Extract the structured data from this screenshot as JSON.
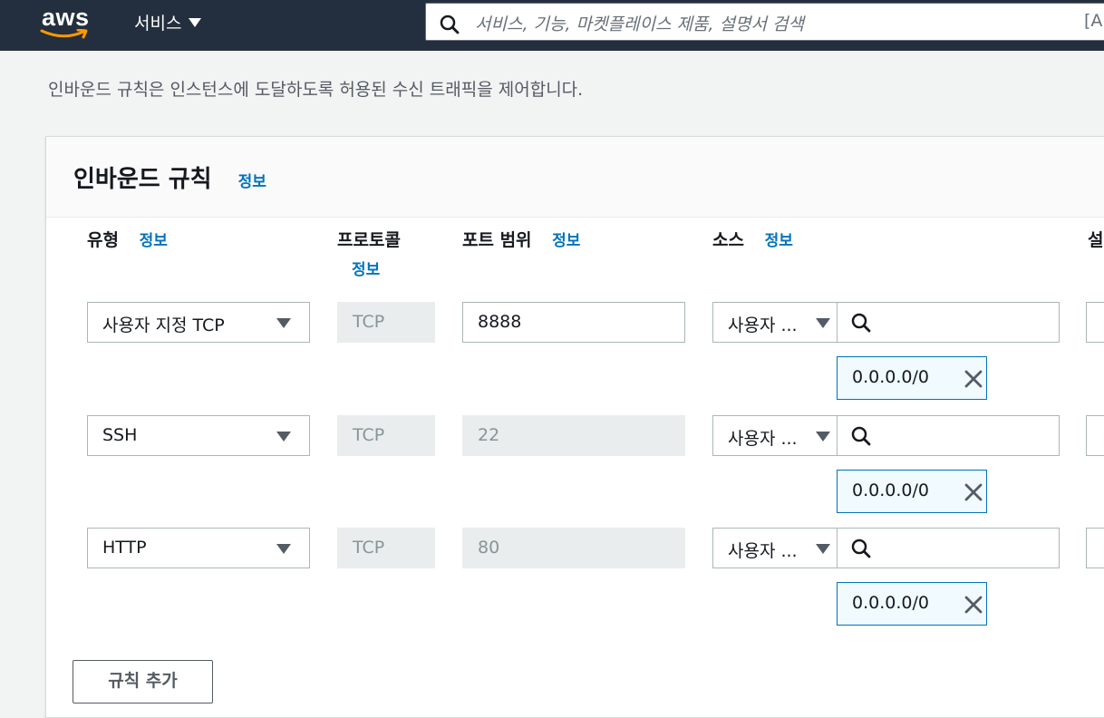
{
  "header": {
    "logo_text": "aws",
    "services_label": "서비스",
    "search_placeholder": "서비스, 기능, 마켓플레이스 제품, 설명서 검색",
    "search_shortcut": "[A"
  },
  "intro": "인바운드 규칙은 인스턴스에 도달하도록 허용된 수신 트래픽을 제어합니다.",
  "panel": {
    "title": "인바운드 규칙",
    "title_info": "정보",
    "columns": {
      "type": "유형",
      "type_info": "정보",
      "protocol": "프로토콜",
      "protocol_info": "정보",
      "port": "포트 범위",
      "port_info": "정보",
      "source": "소스",
      "source_info": "정보",
      "description_partial": "설"
    },
    "rules": [
      {
        "type": "사용자 지정 TCP",
        "protocol": "TCP",
        "port": "8888",
        "port_editable": true,
        "source_type": "사용자 ...",
        "source_token": "0.0.0.0/0"
      },
      {
        "type": "SSH",
        "protocol": "TCP",
        "port": "22",
        "port_editable": false,
        "source_type": "사용자 ...",
        "source_token": "0.0.0.0/0"
      },
      {
        "type": "HTTP",
        "protocol": "TCP",
        "port": "80",
        "port_editable": false,
        "source_type": "사용자 ...",
        "source_token": "0.0.0.0/0"
      }
    ],
    "add_rule_label": "규칙 추가"
  },
  "colors": {
    "topbar": "#232f3e",
    "accent_orange": "#ff9900",
    "link_blue": "#0073bb"
  },
  "icons": [
    "search-icon",
    "caret-down-icon",
    "close-icon"
  ]
}
